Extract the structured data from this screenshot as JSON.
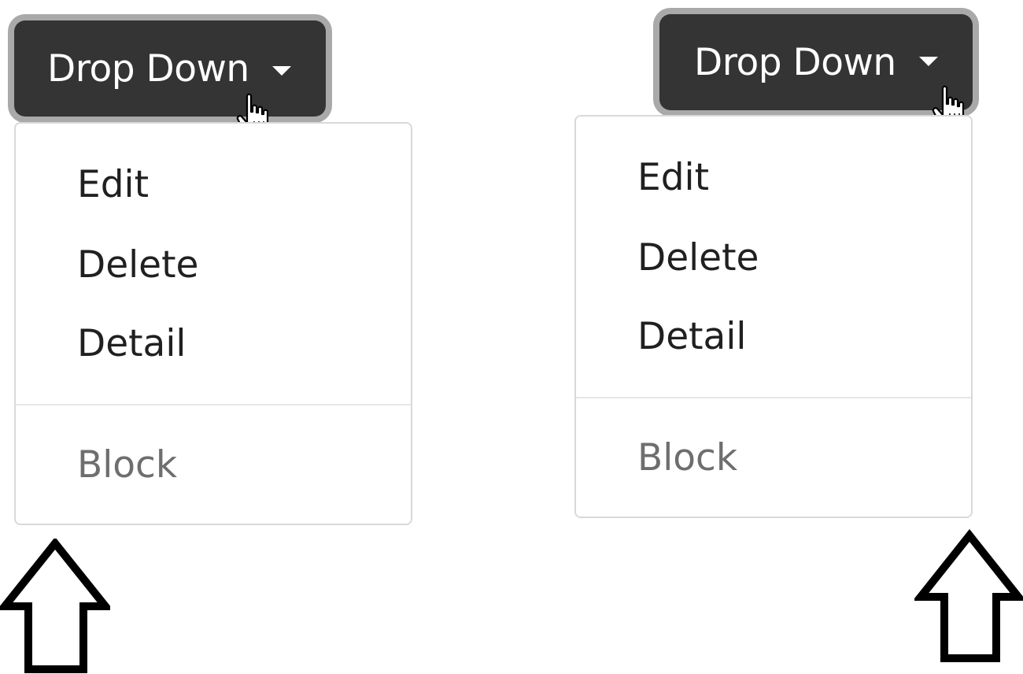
{
  "left_dropdown": {
    "button_label": "Drop Down",
    "items": [
      "Edit",
      "Delete",
      "Detail"
    ],
    "disabled_item": "Block"
  },
  "right_dropdown": {
    "button_label": "Drop Down",
    "items": [
      "Edit",
      "Delete",
      "Detail"
    ],
    "disabled_item": "Block"
  },
  "colors": {
    "button_bg": "#343434",
    "button_ring": "#a9a9a9",
    "menu_border": "#d9d9d9",
    "muted_text": "#6e6e6e"
  },
  "icons": [
    "caret-down-icon",
    "hand-pointer-cursor-icon",
    "up-arrow-icon"
  ]
}
